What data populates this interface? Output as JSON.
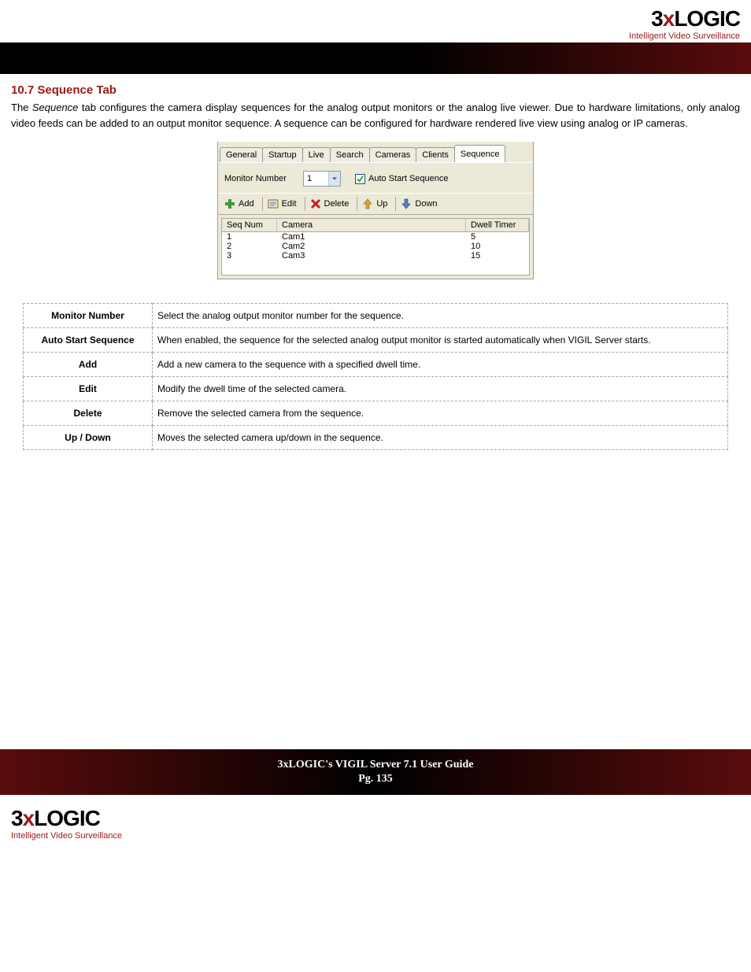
{
  "brand": {
    "name_prefix": "3",
    "name_x": "x",
    "name_suffix": "LOGIC",
    "tagline": "Intelligent Video Surveillance"
  },
  "section": {
    "heading": "10.7 Sequence Tab",
    "body_1": "The ",
    "body_em": "Sequence",
    "body_2": " tab configures the camera display sequences for the analog output monitors or the analog live viewer. Due to hardware limitations, only analog video feeds can be added to an output monitor sequence. A sequence can be configured for hardware rendered live view using analog or IP cameras."
  },
  "tabs": [
    "General",
    "Startup",
    "Live",
    "Search",
    "Cameras",
    "Clients",
    "Sequence"
  ],
  "row1": {
    "monitor_label": "Monitor Number",
    "monitor_value": "1",
    "auto_start_label": "Auto Start Sequence"
  },
  "toolbar": {
    "add": "Add",
    "edit": "Edit",
    "delete": "Delete",
    "up": "Up",
    "down": "Down"
  },
  "grid": {
    "headers": {
      "seq": "Seq Num",
      "cam": "Camera",
      "dwell": "Dwell Timer"
    },
    "rows": [
      {
        "seq": "1",
        "cam": "Cam1",
        "dwell": "5"
      },
      {
        "seq": "2",
        "cam": "Cam2",
        "dwell": "10"
      },
      {
        "seq": "3",
        "cam": "Cam3",
        "dwell": "15"
      }
    ]
  },
  "defs": [
    {
      "term": "Monitor Number",
      "desc": "Select the analog output monitor number for the sequence."
    },
    {
      "term": "Auto Start Sequence",
      "desc": "When enabled, the sequence for the selected analog output monitor is started automatically when VIGIL Server starts."
    },
    {
      "term": "Add",
      "desc": "Add a new camera to the sequence with a specified dwell time."
    },
    {
      "term": "Edit",
      "desc": "Modify the dwell time of the selected camera."
    },
    {
      "term": "Delete",
      "desc": "Remove the selected camera from the sequence."
    },
    {
      "term": "Up / Down",
      "desc": "Moves the selected camera up/down in the sequence."
    }
  ],
  "footer": {
    "title": "3xLOGIC's VIGIL Server 7.1 User Guide",
    "page": "Pg. 135"
  }
}
